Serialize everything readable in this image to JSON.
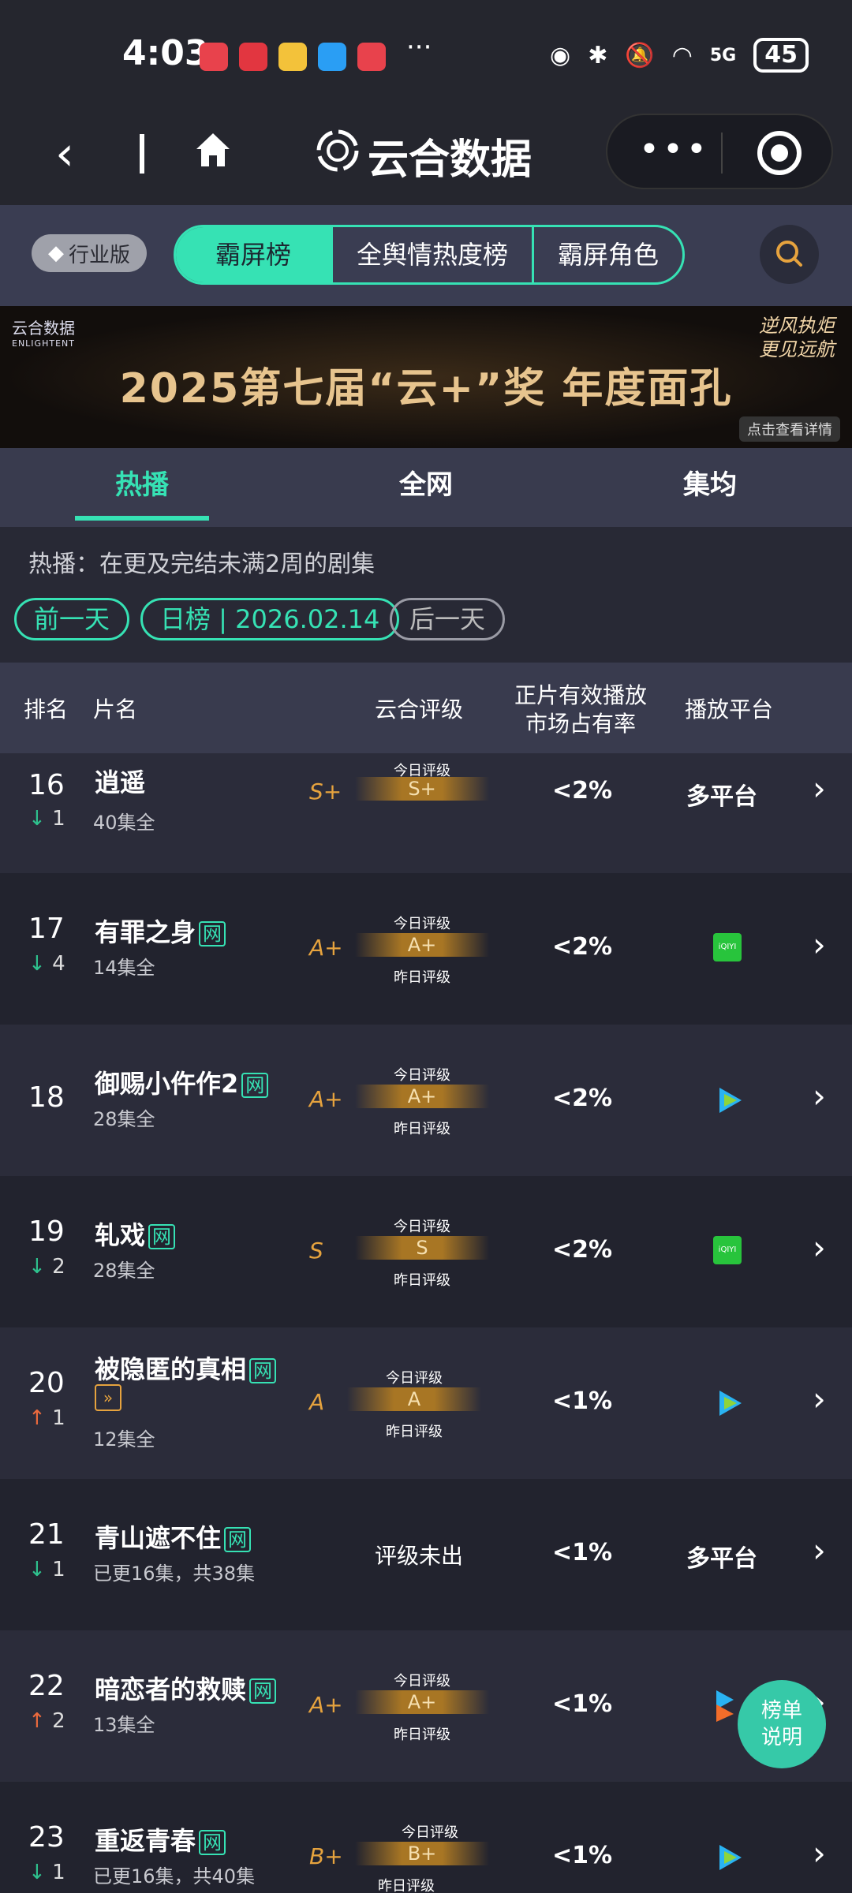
{
  "status": {
    "time": "4:03",
    "battery": "45",
    "network": "5G",
    "more": "···"
  },
  "nav": {
    "back": "‹",
    "brand": "云合数据"
  },
  "topnav": {
    "industry": "行业版",
    "seg": [
      "霸屏榜",
      "全舆情热度榜",
      "霸屏角色"
    ]
  },
  "banner": {
    "logo": "云合数据",
    "logo_en": "ENLIGHTENT",
    "title": "2025第七届“云+”奖  年度面孔",
    "slogan1": "逆风执炬",
    "slogan2": "更见远航",
    "detail": "点击查看详情"
  },
  "tabs": [
    "热播",
    "全网",
    "集均"
  ],
  "filter": {
    "note": "热播：在更及完结未满2周的剧集",
    "prev": "前一天",
    "date": "日榜 | 2026.02.14",
    "next": "后一天"
  },
  "header": {
    "rank": "排名",
    "title": "片名",
    "grade": "云合评级",
    "share1": "正片有效播放",
    "share2": "市场占有率",
    "platform": "播放平台"
  },
  "grade_labels": {
    "today": "今日评级",
    "yesterday": "昨日评级"
  },
  "rows": [
    {
      "rank": "16",
      "change_dir": "down",
      "change": "1",
      "title": "逍遥",
      "tag": "",
      "sub": "40集全",
      "grade": "S+",
      "bar": "S+",
      "share": "<2%",
      "platform": "多平台"
    },
    {
      "rank": "17",
      "change_dir": "down",
      "change": "4",
      "title": "有罪之身",
      "tag": "网",
      "sub": "14集全",
      "grade": "A+",
      "bar": "A+",
      "share": "<2%",
      "platform": "iqiyi"
    },
    {
      "rank": "18",
      "change_dir": "",
      "change": "",
      "title": "御赐小仵作2",
      "tag": "网",
      "sub": "28集全",
      "grade": "A+",
      "bar": "A+",
      "share": "<2%",
      "platform": "tencent"
    },
    {
      "rank": "19",
      "change_dir": "down",
      "change": "2",
      "title": "轧戏",
      "tag": "网",
      "sub": "28集全",
      "grade": "S",
      "bar": "S",
      "share": "<2%",
      "platform": "iqiyi"
    },
    {
      "rank": "20",
      "change_dir": "up",
      "change": "1",
      "title": "被隐匿的真相",
      "tag": "网",
      "sub": "12集全",
      "grade": "A",
      "bar": "A",
      "share": "<1%",
      "platform": "tencent"
    },
    {
      "rank": "21",
      "change_dir": "down",
      "change": "1",
      "title": "青山遮不住",
      "tag": "网",
      "sub": "已更16集，共38集",
      "grade": "",
      "bar": "评级未出",
      "share": "<1%",
      "platform": "多平台"
    },
    {
      "rank": "22",
      "change_dir": "up",
      "change": "2",
      "title": "暗恋者的救赎",
      "tag": "网",
      "sub": "13集全",
      "grade": "A+",
      "bar": "A+",
      "share": "<1%",
      "platform": "youku"
    },
    {
      "rank": "23",
      "change_dir": "down",
      "change": "1",
      "title": "重返青春",
      "tag": "网",
      "sub": "已更16集，共40集",
      "grade": "B+",
      "bar": "B+",
      "share": "<1%",
      "platform": "tencent"
    }
  ],
  "fab": {
    "line1": "榜单",
    "line2": "说明"
  },
  "colors": {
    "accent": "#36e2b4",
    "down": "#2ec28e",
    "up": "#ec6a3d",
    "grade": "#e6a33e"
  }
}
